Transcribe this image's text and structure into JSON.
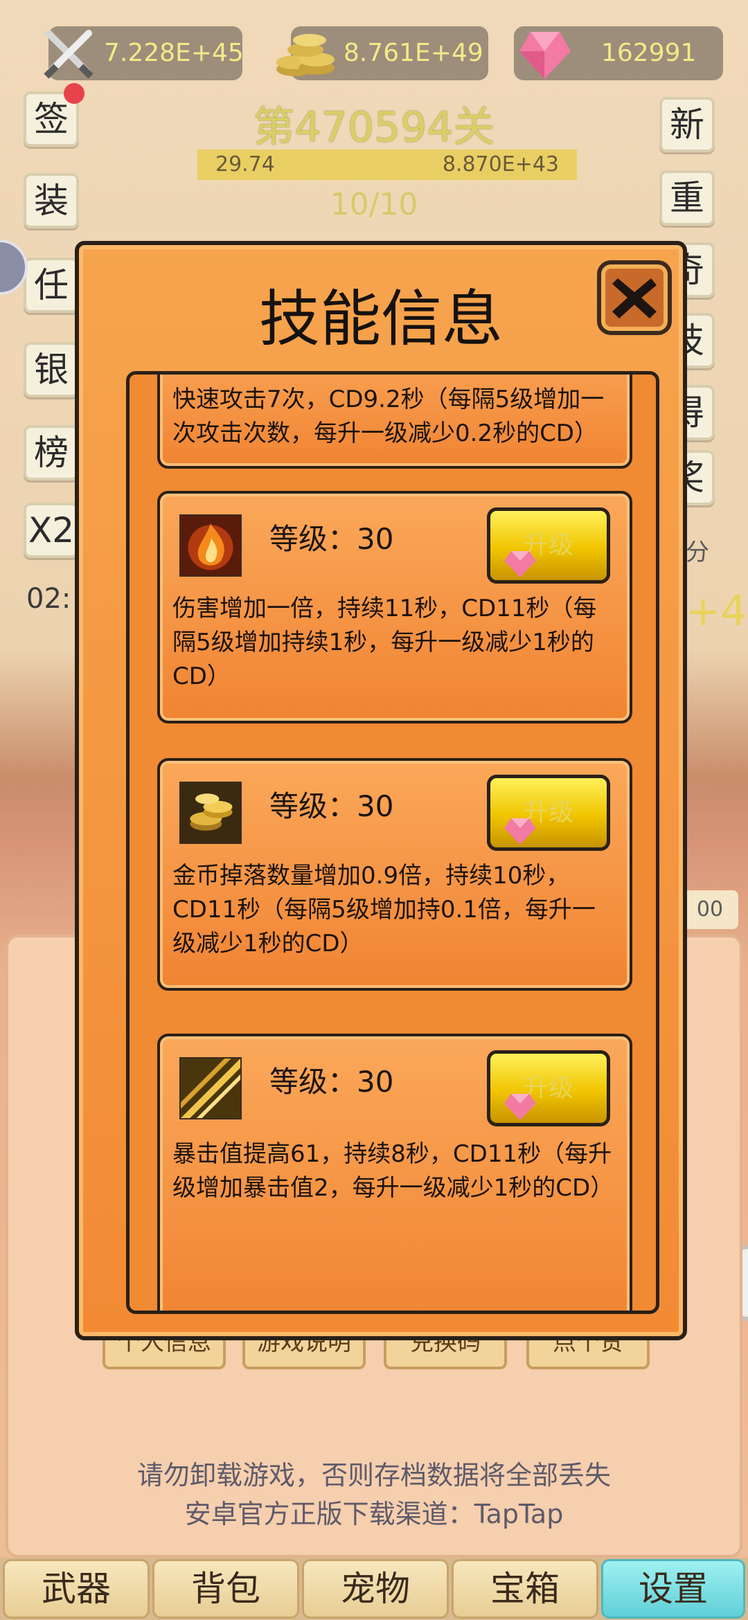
{
  "currency": {
    "attack": "7.228E+45",
    "gold": "8.761E+49",
    "gems": "162991"
  },
  "side_left": [
    "签",
    "装",
    "任",
    "银",
    "榜",
    "X2"
  ],
  "side_left_timer": "02:",
  "side_right": [
    "新",
    "重",
    "奇",
    "技",
    "得",
    "奖",
    "分"
  ],
  "level": {
    "title": "第470594关",
    "hp_left": "29.74",
    "hp_right": "8.870E+43",
    "wave": "10/10"
  },
  "modal": {
    "title": "技能信息",
    "skills": [
      {
        "desc": "快速攻击7次，CD9.2秒（每隔5级增加一次攻击次数，每升一级减少0.2秒的CD）"
      },
      {
        "icon": "flame-burst-icon",
        "level": "等级：30",
        "button": "升级",
        "desc": "伤害增加一倍，持续11秒，CD11秒（每隔5级增加持续1秒，每升一级减少1秒的CD）"
      },
      {
        "icon": "gold-coins-icon",
        "level": "等级：30",
        "button": "升级",
        "desc": "金币掉落数量增加0.9倍，持续10秒，CD11秒（每隔5级增加持0.1倍，每升一级减少1秒的CD）"
      },
      {
        "icon": "golden-streak-icon",
        "level": "等级：30",
        "button": "升级",
        "desc": "暴击值提高61，持续8秒，CD11秒（每升级增加暴击值2，每升一级减少1秒的CD）"
      }
    ]
  },
  "under_buttons": [
    "个人信息",
    "游戏说明",
    "兑换码",
    "点个赞"
  ],
  "notice": {
    "line1": "请勿卸载游戏，否则存档数据将全部丢失",
    "line2": "安卓官方正版下载渠道：TapTap"
  },
  "nav": [
    "武器",
    "背包",
    "宠物",
    "宝箱",
    "设置"
  ],
  "colors": {
    "modal_orange": "#f28a34",
    "upgrade_yellow": "#f0c400",
    "nav_active": "#5fd0d8",
    "currency_text": "#f4ea88"
  }
}
